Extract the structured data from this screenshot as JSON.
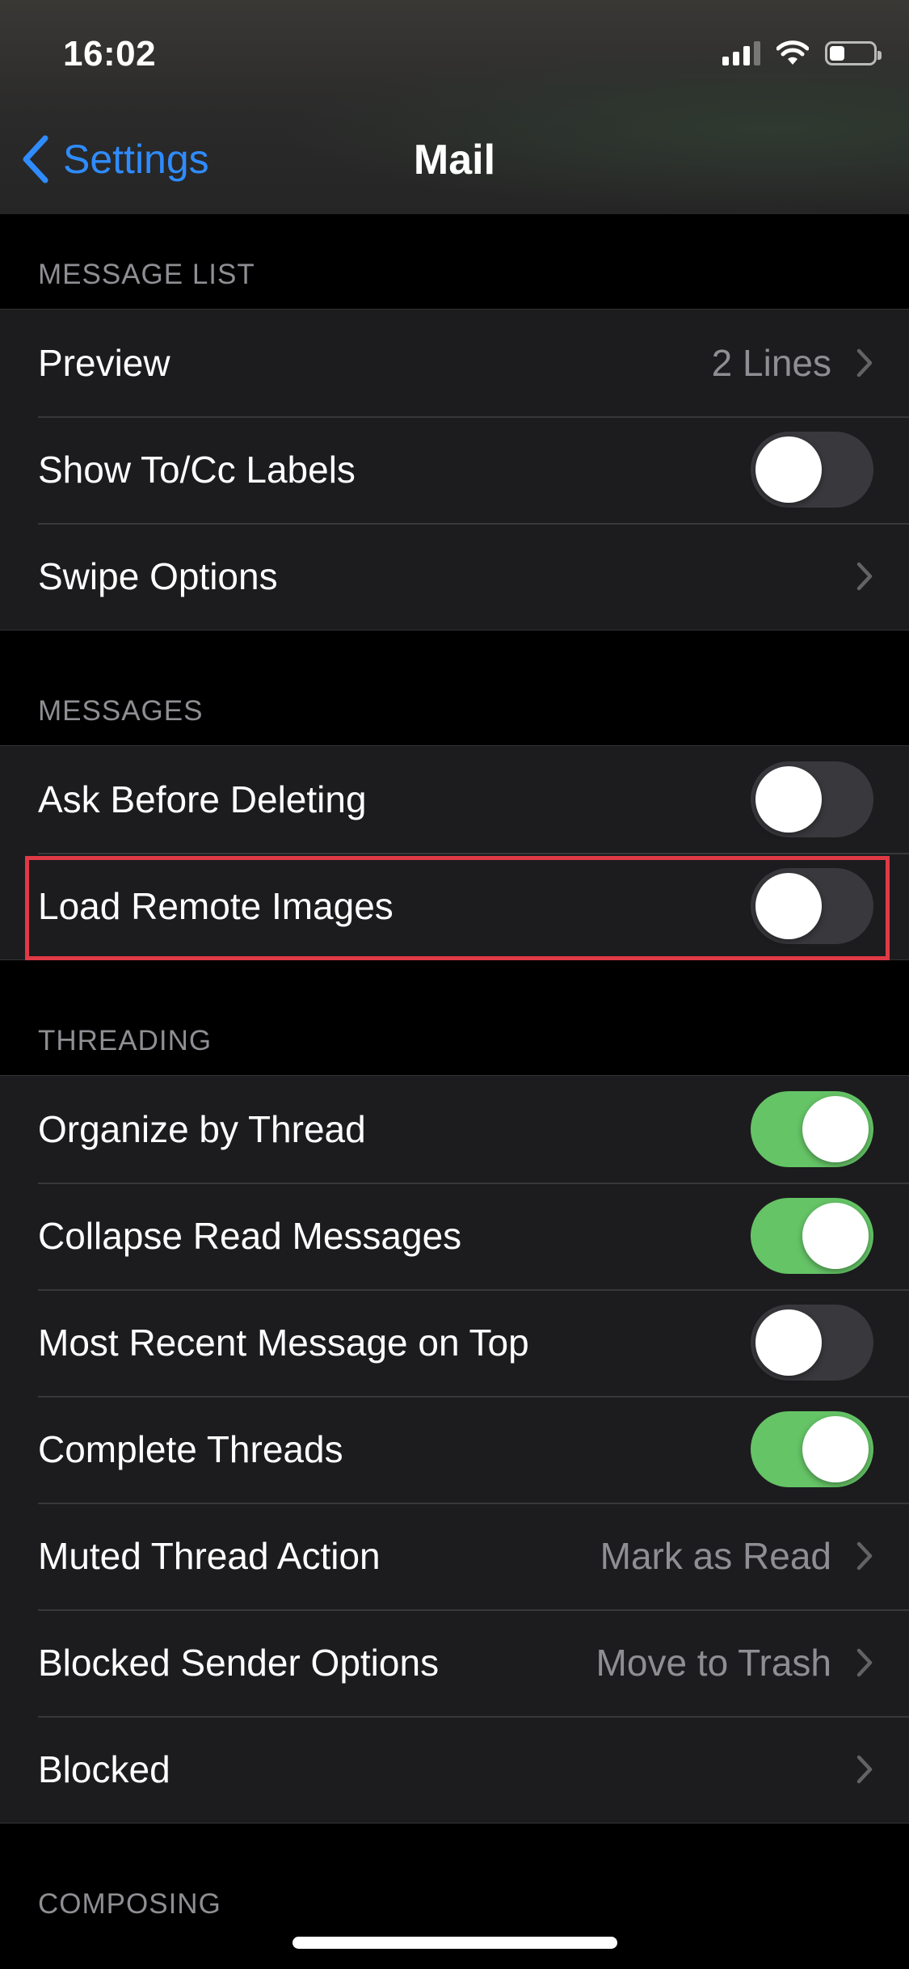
{
  "status_bar": {
    "time": "16:02",
    "battery_level": 0.35
  },
  "nav": {
    "back_label": "Settings",
    "title": "Mail"
  },
  "sections": {
    "message_list": {
      "header": "MESSAGE LIST",
      "preview": {
        "label": "Preview",
        "value": "2 Lines"
      },
      "show_to_cc": {
        "label": "Show To/Cc Labels",
        "on": false
      },
      "swipe_options": {
        "label": "Swipe Options"
      }
    },
    "messages": {
      "header": "MESSAGES",
      "ask_before_deleting": {
        "label": "Ask Before Deleting",
        "on": false
      },
      "load_remote_images": {
        "label": "Load Remote Images",
        "on": false,
        "highlighted": true
      }
    },
    "threading": {
      "header": "THREADING",
      "organize_by_thread": {
        "label": "Organize by Thread",
        "on": true
      },
      "collapse_read": {
        "label": "Collapse Read Messages",
        "on": true
      },
      "most_recent_on_top": {
        "label": "Most Recent Message on Top",
        "on": false
      },
      "complete_threads": {
        "label": "Complete Threads",
        "on": true
      },
      "muted_thread_action": {
        "label": "Muted Thread Action",
        "value": "Mark as Read"
      },
      "blocked_sender_options": {
        "label": "Blocked Sender Options",
        "value": "Move to Trash"
      },
      "blocked": {
        "label": "Blocked"
      }
    },
    "composing": {
      "header": "COMPOSING"
    }
  },
  "colors": {
    "accent": "#2f8cff",
    "toggle_on": "#65c466",
    "toggle_off": "#39393d",
    "highlight": "#e03a46"
  },
  "icons": {
    "back": "chevron-left-icon",
    "disclosure": "chevron-right-icon",
    "signal": "cellular-signal-icon",
    "wifi": "wifi-icon",
    "battery": "battery-icon"
  }
}
